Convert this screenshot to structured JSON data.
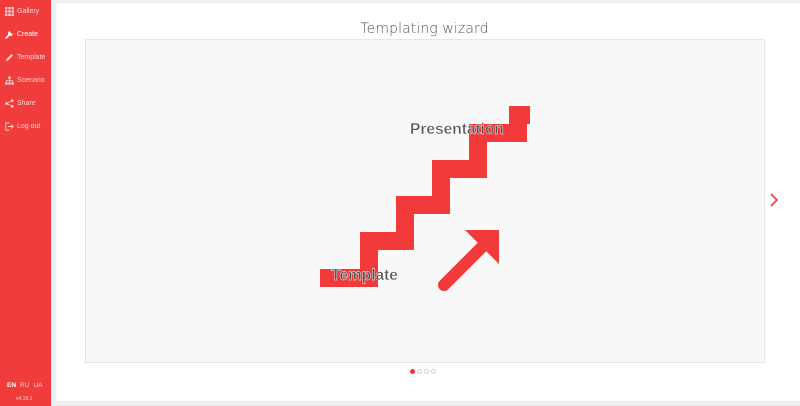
{
  "sidebar": {
    "items": [
      {
        "label": "Gallery",
        "icon": "grid-icon"
      },
      {
        "label": "Create",
        "icon": "wrench-icon"
      },
      {
        "label": "Template",
        "icon": "pencil-icon"
      },
      {
        "label": "Scenario",
        "icon": "sitemap-icon"
      },
      {
        "label": "Share",
        "icon": "share-icon"
      },
      {
        "label": "Log out",
        "icon": "logout-icon"
      }
    ],
    "languages": [
      "EN",
      "RU",
      "UA"
    ],
    "version": "v4.18.1"
  },
  "main": {
    "title": "Templating wizard",
    "slide": {
      "start_label": "Template",
      "end_label": "Presentation"
    },
    "carousel": {
      "slides": 4,
      "active": 1
    }
  },
  "colors": {
    "accent": "#f13c3c",
    "stairs": "#f23a3a",
    "text": "#555555"
  }
}
